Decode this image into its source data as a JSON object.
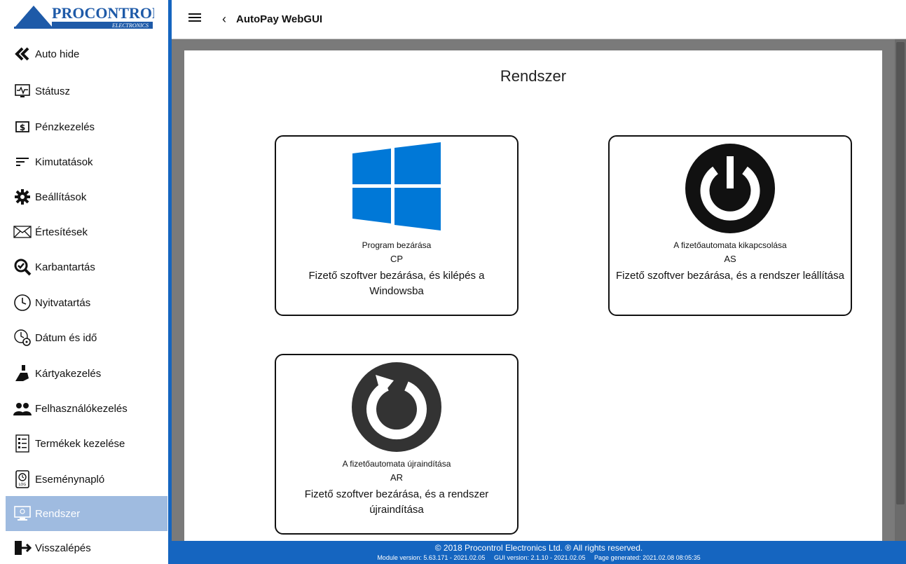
{
  "logo": {
    "brand": "PROCONTROL",
    "sub": "ELECTRONICS"
  },
  "header": {
    "title": "AutoPay WebGUI",
    "back_glyph": "‹"
  },
  "sidebar": {
    "items": [
      {
        "label": "Auto hide",
        "icon": "double-chevron-left-icon"
      },
      {
        "label": "Státusz",
        "icon": "monitor-pulse-icon"
      },
      {
        "label": "Pénzkezelés",
        "icon": "dollar-box-icon"
      },
      {
        "label": "Kimutatások",
        "icon": "lines-icon"
      },
      {
        "label": "Beállítások",
        "icon": "gear-icon"
      },
      {
        "label": "Értesítések",
        "icon": "envelope-icon"
      },
      {
        "label": "Karbantartás",
        "icon": "wrench-check-icon"
      },
      {
        "label": "Nyitvatartás",
        "icon": "clock-icon"
      },
      {
        "label": "Dátum és idő",
        "icon": "clock-gear-icon"
      },
      {
        "label": "Kártyakezelés",
        "icon": "card-hand-icon"
      },
      {
        "label": "Felhasználókezelés",
        "icon": "users-icon"
      },
      {
        "label": "Termékek kezelése",
        "icon": "product-list-icon"
      },
      {
        "label": "Eseménynapló",
        "icon": "log-icon"
      },
      {
        "label": "Rendszer",
        "icon": "computer-icon",
        "active": true
      },
      {
        "label": "Visszalépés",
        "icon": "logout-icon"
      }
    ]
  },
  "main": {
    "title": "Rendszer",
    "cards": [
      {
        "name": "Program bezárása",
        "code": "CP",
        "desc": "Fizető szoftver bezárása, és kilépés a Windowsba",
        "icon": "windows-logo-icon"
      },
      {
        "name": "A fizetőautomata kikapcsolása",
        "code": "AS",
        "desc": "Fizető szoftver bezárása, és a rendszer leállítása",
        "icon": "power-icon"
      },
      {
        "name": "A fizetőautomata újraindítása",
        "code": "AR",
        "desc": "Fizető szoftver bezárása, és a rendszer újraindítása",
        "icon": "restart-icon"
      }
    ]
  },
  "footer": {
    "copyright": "© 2018 Procontrol Electronics Ltd. ® All rights reserved.",
    "module_version": "Module version: 5.63.171 - 2021.02.05",
    "gui_version": "GUI version: 2.1.10 - 2021.02.05",
    "page_generated": "Page generated: 2021.02.08 08:05:35"
  },
  "colors": {
    "accent": "#1565c0",
    "active_bg": "#9fbbe0",
    "windows_blue": "#0078d7",
    "icon_dark": "#111111"
  }
}
